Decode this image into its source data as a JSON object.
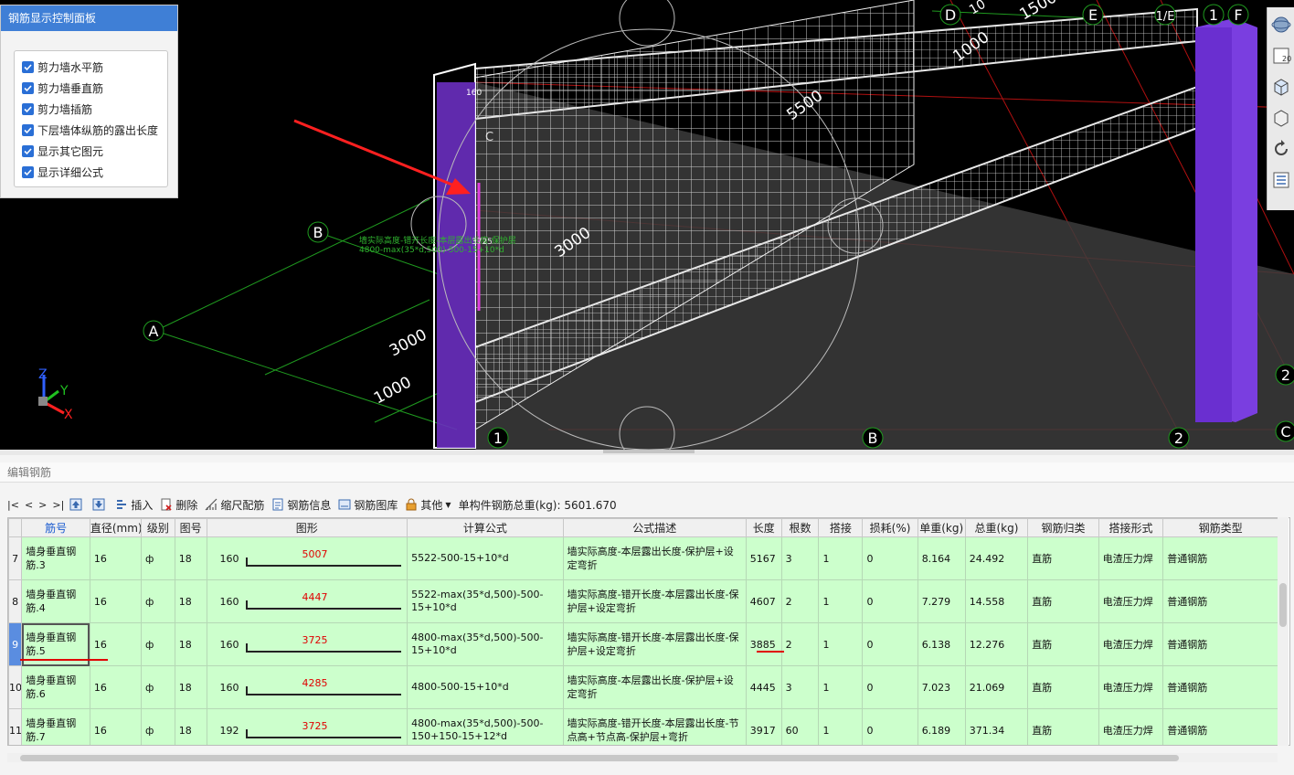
{
  "control_panel": {
    "title": "钢筋显示控制面板",
    "items": [
      {
        "label": "剪力墙水平筋",
        "checked": true
      },
      {
        "label": "剪力墙垂直筋",
        "checked": true
      },
      {
        "label": "剪力墙插筋",
        "checked": true
      },
      {
        "label": "下层墙体纵筋的露出长度",
        "checked": true
      },
      {
        "label": "显示其它图元",
        "checked": true
      },
      {
        "label": "显示详细公式",
        "checked": true
      }
    ]
  },
  "viewport": {
    "axis_labels": {
      "a": "A",
      "b": "B",
      "c": "C",
      "d": "D",
      "e": "E",
      "f": "F",
      "le": "1/E",
      "one": "1",
      "two": "2",
      "b2": "B",
      "two2": "2",
      "c2": "C",
      "one2": "1",
      "two3": "2"
    },
    "dims": {
      "d3000": "3000",
      "d1000": "1000",
      "d5500": "5500",
      "d3000b": "3000",
      "d1000b": "1000",
      "d1500": "1500",
      "d160": "160",
      "d10": "10"
    },
    "annotation_line1": "墙实际高度-错开长度-本层露出长度-保护层",
    "annotation_line2": "4800-max(35*d,500)-500-15+10*d",
    "annotation_value": "3725",
    "axes": {
      "x": "X",
      "y": "Y",
      "z": "Z"
    },
    "tool_20": "20"
  },
  "editor": {
    "title": "编辑钢筋",
    "nav": [
      "|<",
      "<",
      ">",
      ">|"
    ],
    "toolbar": {
      "insert": "插入",
      "delete": "删除",
      "scale": "缩尺配筋",
      "info": "钢筋信息",
      "library": "钢筋图库",
      "other": "其他",
      "total": "单构件钢筋总重(kg): 5601.670"
    },
    "columns": [
      "筋号",
      "直径(mm)",
      "级别",
      "图号",
      "图形",
      "计算公式",
      "公式描述",
      "长度",
      "根数",
      "搭接",
      "损耗(%)",
      "单重(kg)",
      "总重(kg)",
      "钢筋归类",
      "搭接形式",
      "钢筋类型"
    ],
    "rows": [
      {
        "num": "7",
        "name": "墙身垂直钢筋.3",
        "dia": "16",
        "grade": "ф",
        "fig": "18",
        "shape_len": "160",
        "shape_val": "5007",
        "formula": "5522-500-15+10*d",
        "desc": "墙实际高度-本层露出长度-保护层+设定弯折",
        "length": "5167",
        "count": "3",
        "lap": "1",
        "loss": "0",
        "unit_w": "8.164",
        "total_w": "24.492",
        "cat": "直筋",
        "lap_type": "电渣压力焊",
        "type": "普通钢筋"
      },
      {
        "num": "8",
        "name": "墙身垂直钢筋.4",
        "dia": "16",
        "grade": "ф",
        "fig": "18",
        "shape_len": "160",
        "shape_val": "4447",
        "formula": "5522-max(35*d,500)-500-15+10*d",
        "desc": "墙实际高度-错开长度-本层露出长度-保护层+设定弯折",
        "length": "4607",
        "count": "2",
        "lap": "1",
        "loss": "0",
        "unit_w": "7.279",
        "total_w": "14.558",
        "cat": "直筋",
        "lap_type": "电渣压力焊",
        "type": "普通钢筋"
      },
      {
        "num": "9",
        "name": "墙身垂直钢筋.5",
        "dia": "16",
        "grade": "ф",
        "fig": "18",
        "shape_len": "160",
        "shape_val": "3725",
        "formula": "4800-max(35*d,500)-500-15+10*d",
        "desc": "墙实际高度-错开长度-本层露出长度-保护层+设定弯折",
        "length": "3885",
        "count": "2",
        "lap": "1",
        "loss": "0",
        "unit_w": "6.138",
        "total_w": "12.276",
        "cat": "直筋",
        "lap_type": "电渣压力焊",
        "type": "普通钢筋"
      },
      {
        "num": "10",
        "name": "墙身垂直钢筋.6",
        "dia": "16",
        "grade": "ф",
        "fig": "18",
        "shape_len": "160",
        "shape_val": "4285",
        "formula": "4800-500-15+10*d",
        "desc": "墙实际高度-本层露出长度-保护层+设定弯折",
        "length": "4445",
        "count": "3",
        "lap": "1",
        "loss": "0",
        "unit_w": "7.023",
        "total_w": "21.069",
        "cat": "直筋",
        "lap_type": "电渣压力焊",
        "type": "普通钢筋"
      },
      {
        "num": "11",
        "name": "墙身垂直钢筋.7",
        "dia": "16",
        "grade": "ф",
        "fig": "18",
        "shape_len": "192",
        "shape_val": "3725",
        "formula": "4800-max(35*d,500)-500-150+150-15+12*d",
        "desc": "墙实际高度-错开长度-本层露出长度-节点高+节点高-保护层+弯折",
        "length": "3917",
        "count": "60",
        "lap": "1",
        "loss": "0",
        "unit_w": "6.189",
        "total_w": "371.34",
        "cat": "直筋",
        "lap_type": "电渣压力焊",
        "type": "普通钢筋"
      }
    ]
  }
}
